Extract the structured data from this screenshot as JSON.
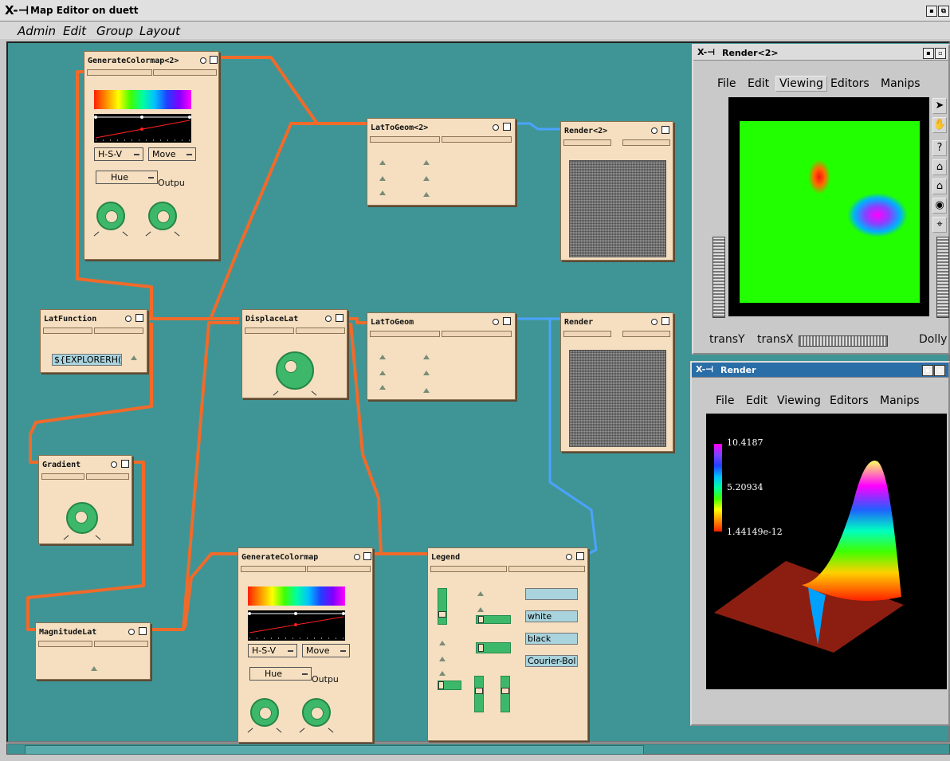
{
  "app": {
    "title": "Map Editor on duett",
    "logo": "X-icon",
    "menu": [
      "Admin",
      "Edit",
      "Group",
      "Layout"
    ]
  },
  "modules": {
    "gen_cmap2": {
      "title": "GenerateColormap<2>",
      "hsv": "H-S-V",
      "move": "Move",
      "hue": "Hue",
      "output": "Outpu"
    },
    "lattogeom2": {
      "title": "LatToGeom<2>"
    },
    "render2": {
      "title": "Render<2>"
    },
    "latfunction": {
      "title": "LatFunction",
      "field": "${EXPLORERH("
    },
    "displacelat": {
      "title": "DisplaceLat"
    },
    "lattogeom": {
      "title": "LatToGeom"
    },
    "render": {
      "title": "Render"
    },
    "gradient": {
      "title": "Gradient"
    },
    "magnitudelat": {
      "title": "MagnitudeLat"
    },
    "gen_cmap": {
      "title": "GenerateColormap",
      "hsv": "H-S-V",
      "move": "Move",
      "hue": "Hue",
      "output": "Outpu"
    },
    "legend": {
      "title": "Legend",
      "fields": [
        "",
        "white",
        "black",
        "Courier-Bol"
      ]
    }
  },
  "render_window_2": {
    "title": "Render<2>",
    "menu": [
      "File",
      "Edit",
      "Viewing",
      "Editors",
      "Manips"
    ],
    "active_menu": "Viewing",
    "wheel_labels": {
      "left": "transY",
      "middle": "transX",
      "right": "Dolly"
    },
    "side_icons": [
      "arrow-icon",
      "hand-icon",
      "help-icon",
      "home-icon",
      "set-home-icon",
      "view-all-icon",
      "seek-icon"
    ],
    "help_glyph": "?"
  },
  "render_window": {
    "title": "Render",
    "menu": [
      "File",
      "Edit",
      "Viewing",
      "Editors",
      "Manips"
    ],
    "legend_labels": [
      "10.4187",
      "5.20934",
      "1.44149e-12"
    ]
  },
  "colors": {
    "canvas": "#3f9595",
    "module": "#f5dfc0",
    "wire_orange": "#f06a2a",
    "wire_blue": "#4aa3ff"
  }
}
